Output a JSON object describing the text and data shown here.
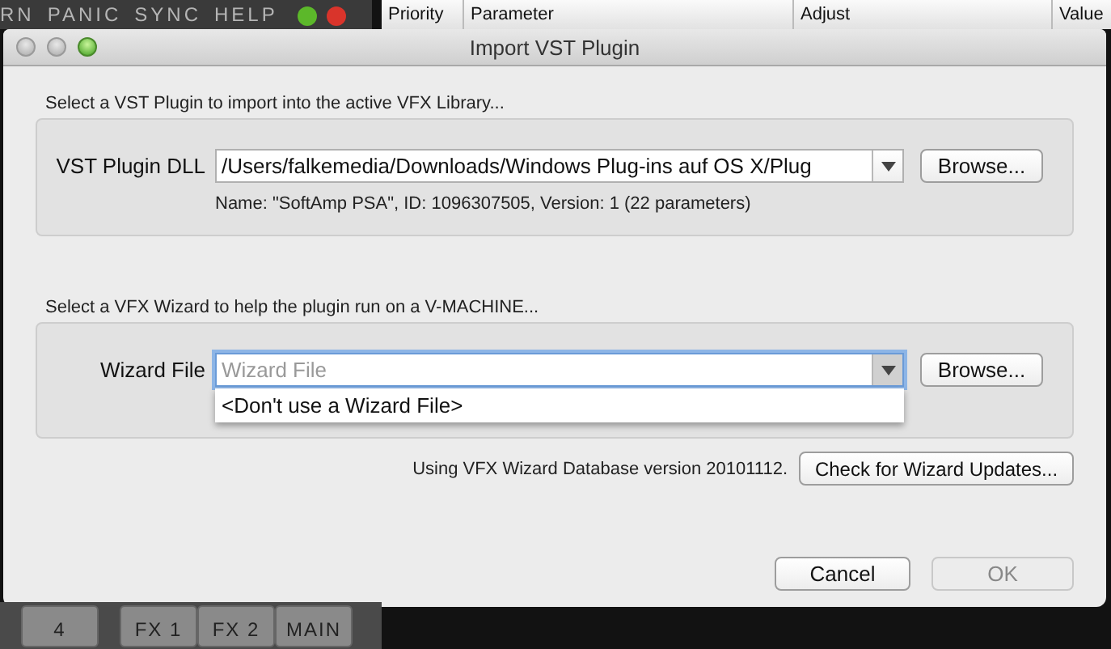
{
  "background_app": {
    "menu": [
      "RN",
      "PANIC",
      "SYNC",
      "HELP"
    ],
    "table_columns": [
      "Priority",
      "Parameter",
      "Adjust",
      "Value"
    ],
    "channel_buttons": [
      "4",
      "FX 1",
      "FX 2",
      "MAIN"
    ]
  },
  "dialog": {
    "title": "Import VST Plugin",
    "plugin_section": {
      "caption": "Select a VST Plugin to import into the active VFX Library...",
      "label": "VST Plugin DLL",
      "value": "/Users/falkemedia/Downloads/Windows Plug-ins auf OS X/Plug",
      "browse": "Browse...",
      "info": "Name: \"SoftAmp PSA\", ID: 1096307505, Version: 1 (22 parameters)"
    },
    "wizard_section": {
      "caption": "Select a VFX Wizard to help the plugin run on a V-MACHINE...",
      "label": "Wizard File",
      "placeholder": "Wizard File",
      "expanded": true,
      "options": [
        "<Don't use a Wizard File>"
      ],
      "browse": "Browse..."
    },
    "database_text": "Using VFX Wizard Database version 20101112.",
    "update_button": "Check for Wizard Updates...",
    "buttons": [
      {
        "label": "Cancel",
        "disabled": false
      },
      {
        "label": "OK",
        "disabled": true
      }
    ]
  }
}
